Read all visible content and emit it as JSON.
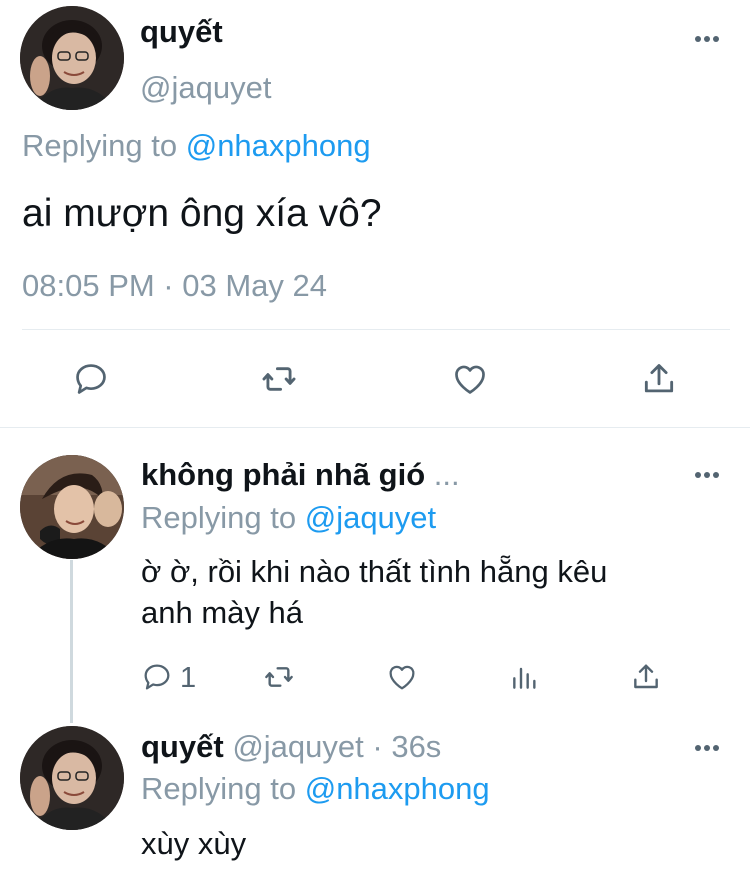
{
  "main_tweet": {
    "display_name": "quyết",
    "handle": "@jaquyet",
    "replying_prefix": "Replying to",
    "replying_handle": "@nhaxphong",
    "text": "ai mượn ông xía vô?",
    "timestamp": "08:05 PM · 03 May 24",
    "actions": [
      "reply-icon",
      "retweet-icon",
      "like-icon",
      "share-icon"
    ]
  },
  "reply_1": {
    "display_name": "không phải nhã gió",
    "ellipsis": "...",
    "replying_prefix": "Replying to",
    "replying_handle": "@jaquyet",
    "text_line1": "ờ ờ, rồi khi nào thất tình hẵng kêu",
    "text_line2": "anh mày há",
    "reply_count": "1",
    "actions": [
      "reply-icon",
      "retweet-icon",
      "like-icon",
      "analytics-icon",
      "share-icon"
    ]
  },
  "reply_2": {
    "display_name": "quyết",
    "handle": "@jaquyet",
    "separator": "·",
    "time": "36s",
    "replying_prefix": "Replying to",
    "replying_handle": "@nhaxphong",
    "text": "xùy xùy"
  },
  "colors": {
    "text": "#0f1419",
    "muted": "#8899a6",
    "link": "#1d9bf0",
    "icon": "#536471",
    "divider": "#e6ecf0"
  }
}
